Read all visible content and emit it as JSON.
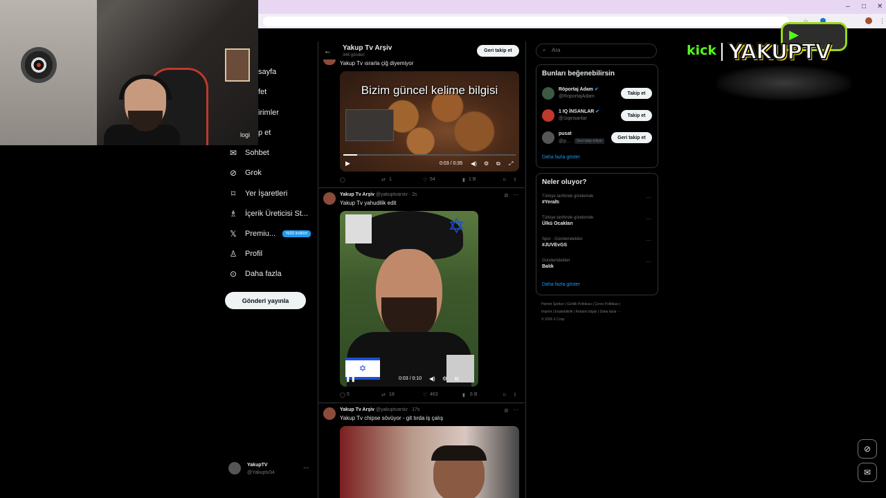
{
  "browser": {
    "minimize": "–",
    "maximize": "□",
    "close": "✕"
  },
  "nav": {
    "items": [
      {
        "label": "sayfa",
        "icon": "home-icon"
      },
      {
        "label": "fet",
        "icon": "explore-icon"
      },
      {
        "label": "irimler",
        "icon": "bell-icon"
      },
      {
        "label": "p et",
        "icon": "mail-icon"
      },
      {
        "label": "Sohbet",
        "icon": "chat-icon"
      },
      {
        "label": "Grok",
        "icon": "grok-icon"
      },
      {
        "label": "Yer İşaretleri",
        "icon": "bookmark-icon"
      },
      {
        "label": "İçerik Üreticisi St...",
        "icon": "creator-icon"
      },
      {
        "label": "Premiu...",
        "icon": "x-logo-icon",
        "badge": "%50 indirim"
      },
      {
        "label": "Profil",
        "icon": "person-icon"
      },
      {
        "label": "Daha fazla",
        "icon": "more-circle-icon"
      }
    ],
    "post_button": "Gönderi yayınla",
    "logi": "logi",
    "account": {
      "name": "YakupTV",
      "handle": "@Yakuptv34",
      "more": "···"
    }
  },
  "header": {
    "title": "Yakup Tv Arşiv",
    "subtitle": "348 gönderi",
    "follow_back": "Geri takip et"
  },
  "tweets": [
    {
      "text": "Yakup Tv ısrarla çiğ diyemiyor",
      "video_caption": "Bizim güncel kelime bilgisi",
      "time": "0:03 / 0:35",
      "replies": "",
      "retweets": "1",
      "likes": "54",
      "views": "1 B"
    },
    {
      "author": "Yakup Tv Arşiv",
      "handle": "@yakuptvarsiv · 2s",
      "text": "Yakup Tv yahudilik edit",
      "time": "0:03 / 0:10",
      "replies": "5",
      "retweets": "18",
      "likes": "463",
      "views": "6 B"
    },
    {
      "author": "Yakup Tv Arşiv",
      "handle": "@yakuptvarsiv · 17s",
      "text": "Yakup Tv chipse sövüyor - git tırda iş çalış"
    }
  ],
  "search": {
    "placeholder": "Ara"
  },
  "who_to_follow": {
    "title": "Bunları beğenebilirsin",
    "users": [
      {
        "name": "Röportaj Adam",
        "handle": "@RoportajAdam",
        "button": "Takip et",
        "verified": true
      },
      {
        "name": "1 IQ İNSANLAR",
        "handle": "@1iqinsanlar",
        "button": "Takip et",
        "verified": true
      },
      {
        "name": "pusat",
        "handle": "@p...",
        "follows_you": "Seni takip ediyor",
        "button": "Geri takip et",
        "verified": false
      }
    ],
    "show_more": "Daha fazla göster"
  },
  "trends": {
    "title": "Neler oluyor?",
    "items": [
      {
        "context": "Türkiye tarihinde gündemde",
        "name": "#Yeraltı"
      },
      {
        "context": "Türkiye tarihinde gündemde",
        "name": "Ülkü Ocakları"
      },
      {
        "context": "Spor · Gündemdekiler",
        "name": "#JUVEvGS"
      },
      {
        "context": "Gündemdekiler",
        "name": "Balık"
      }
    ],
    "show_more": "Daha fazla göster"
  },
  "footer": {
    "line1": "Hizmet Şartları  |  Gizlilik Politikası  |  Çerez Politikası  |",
    "line2": "Imprint  |  Erişilebilirlik  |  Reklam bilgisi  |  Daha fazla ···",
    "line3": "© 2026 X Corp."
  },
  "overlay": {
    "kick": "kick",
    "brand": "YAKUPTV"
  },
  "colors": {
    "accent": "#1d9bf0",
    "bg": "#000000",
    "kick": "#53fc18",
    "brand_yellow": "#f5d90a"
  }
}
